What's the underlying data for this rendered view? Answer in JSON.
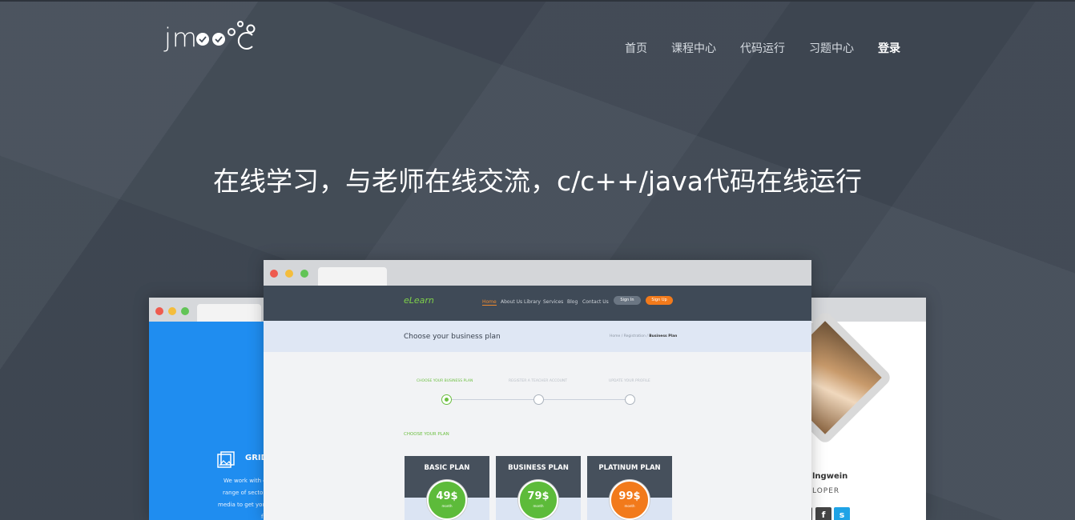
{
  "header": {
    "logo_text": "jm",
    "nav": [
      "首页",
      "课程中心",
      "代码运行",
      "习题中心",
      "登录"
    ]
  },
  "hero": {
    "headline": "在线学习，与老师在线交流，c/c++/java代码在线运行"
  },
  "left_mockup": {
    "feature_label": "GRID",
    "text_lines": [
      "We work with cli",
      "range of sector",
      "media to get your",
      "f"
    ]
  },
  "right_mockup": {
    "name": "lngwein",
    "role": "LOPER",
    "social": [
      "f",
      "s"
    ]
  },
  "main_mockup": {
    "logo": "eLearn",
    "nav": [
      "Home",
      "About Us",
      "Library",
      "Services",
      "Blog",
      "Contact Us"
    ],
    "sign_in": "Sign In",
    "sign_up": "Sign Up",
    "page_title": "Choose your business plan",
    "breadcrumb": [
      "Home",
      "Registration",
      "Business Plan"
    ],
    "steps": [
      "CHOOSE YOUR BUSINESS PLAN",
      "REGISTER A TEACHER ACCOUNT",
      "UPDATE YOUR PROFILE"
    ],
    "choose_label": "CHOOSE YOUR PLAN",
    "plans": [
      {
        "name": "BASIC PLAN",
        "price": "49$",
        "per": "month",
        "color": "#5dbb3a"
      },
      {
        "name": "BUSINESS PLAN",
        "price": "79$",
        "per": "month",
        "color": "#5dbb3a"
      },
      {
        "name": "PLATINUM PLAN",
        "price": "99$",
        "per": "month",
        "color": "#f27a1b"
      }
    ]
  },
  "colors": {
    "background": "#424b57",
    "accent_green": "#6bbf3f",
    "accent_orange": "#f27a1b",
    "accent_blue": "#1f8df0"
  }
}
